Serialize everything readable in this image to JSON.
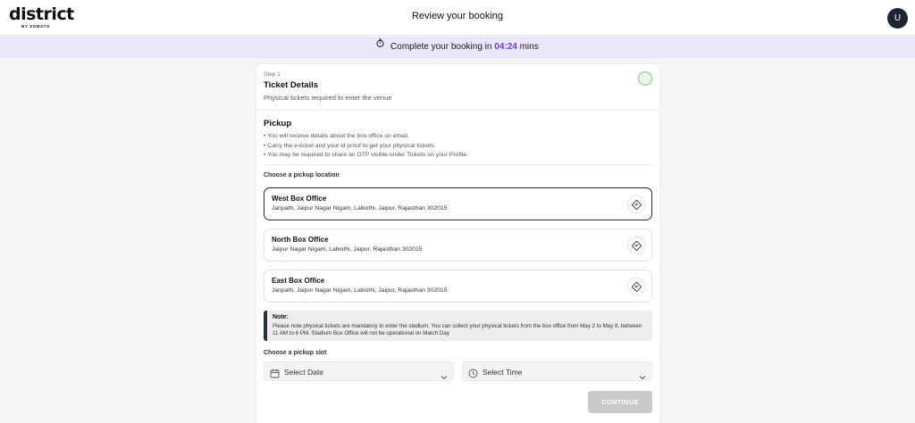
{
  "header": {
    "logo_text": "district",
    "logo_subtext": "BY ZOMATO",
    "page_title": "Review your booking",
    "avatar_initial": "U"
  },
  "timer": {
    "prefix": "Complete your booking in",
    "time": "04:24",
    "suffix": "mins",
    "icon": "stopwatch-icon"
  },
  "step": {
    "label": "Step 1",
    "title": "Ticket Details",
    "subtitle": "Physical tickets required to enter the venue"
  },
  "pickup": {
    "title": "Pickup",
    "bullets": [
      "You will receive details about the box office on email.",
      "Carry the e-ticket and your id proof to get your physical tickets.",
      "You may be required to share an OTP visible under Tickets on your Profile."
    ],
    "choose_location_label": "Choose a pickup location",
    "locations": [
      {
        "name": "West Box Office",
        "address": "Janpath, Jaipur Nagar Nigam, Lalkothi, Jaipur, Rajasthan 302015",
        "selected": true
      },
      {
        "name": "North Box Office",
        "address": "Jaipur Nagar Nigam, Lalkothi, Jaipur, Rajasthan 302015",
        "selected": false
      },
      {
        "name": "East Box Office",
        "address": "Janpath, Jaipur Nagar Nigam, Lalkothi, Jaipur, Rajasthan 302015",
        "selected": false
      }
    ]
  },
  "note": {
    "title": "Note:",
    "text": "Please note physical tickets are mandatory to enter the stadium. You can collect your physical tickets from the box office from May 2 to May 8, between 11 AM to 6 PM. Stadium Box Office will not be operational on Match Day"
  },
  "slot": {
    "label": "Choose a pickup slot",
    "date_placeholder": "Select Date",
    "time_placeholder": "Select Time"
  },
  "continue_label": "CONTINUE",
  "colors": {
    "timer_bg": "#ece6fb",
    "timer_accent": "#6c3fd6",
    "avatar_bg": "#1f2533",
    "button_disabled": "#c9c9c9",
    "selected_border": "#2a2a2a"
  }
}
